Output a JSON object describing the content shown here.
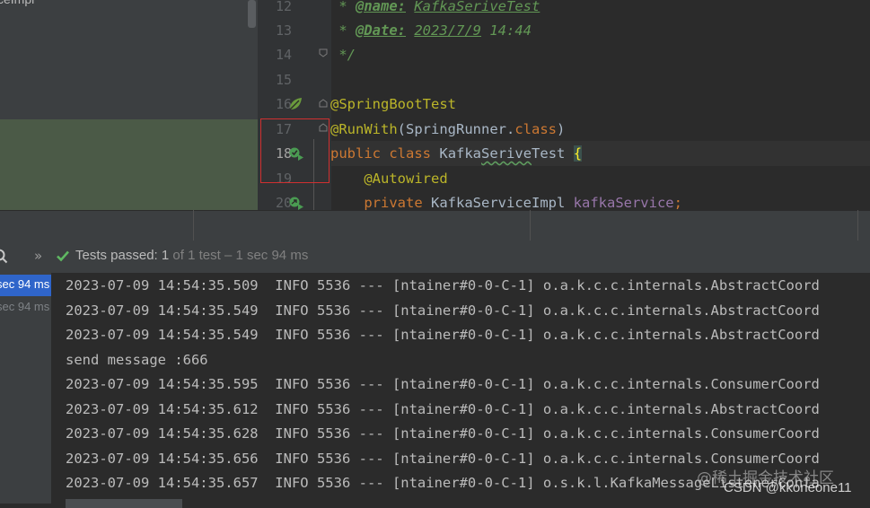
{
  "project_tree": {
    "item_label": "ceImpl"
  },
  "editor": {
    "line_numbers": [
      "12",
      "13",
      "14",
      "15",
      "16",
      "17",
      "18",
      "19",
      "20"
    ],
    "lines": {
      "l12": {
        "prefix": " * ",
        "tag": "@name:",
        "value": "KafkaSeriveTest"
      },
      "l13": {
        "prefix": " * ",
        "tag": "@Date:",
        "value": "2023/7/9",
        "rest": " 14:44"
      },
      "l14": {
        "text": " */"
      },
      "l16": {
        "annotation": "@SpringBootTest"
      },
      "l17": {
        "annotation": "@RunWith",
        "open": "(",
        "class_name": "SpringRunner",
        "dot": ".",
        "kw_class": "class",
        "close": ")"
      },
      "l18": {
        "kw_public": "public",
        "kw_class": "class",
        "name_pre": "Kafka",
        "name_squig": "Serive",
        "name_post": "Test",
        "brace": "{"
      },
      "l19": {
        "annotation": "@Autowired"
      },
      "l20": {
        "kw_private": "private",
        "type": "KafkaServiceImpl",
        "field": "kafkaService",
        "semi": ";"
      }
    }
  },
  "run_panel": {
    "status": {
      "label": "Tests passed:",
      "count": "1",
      "detail": "of 1 test – 1 sec 94 ms"
    },
    "results": [
      "sec 94 ms",
      "sec 94 ms"
    ],
    "console_lines": [
      "2023-07-09 14:54:35.509  INFO 5536 --- [ntainer#0-0-C-1] o.a.k.c.c.internals.AbstractCoord",
      "2023-07-09 14:54:35.549  INFO 5536 --- [ntainer#0-0-C-1] o.a.k.c.c.internals.AbstractCoord",
      "2023-07-09 14:54:35.549  INFO 5536 --- [ntainer#0-0-C-1] o.a.k.c.c.internals.AbstractCoord",
      "send message :666",
      "2023-07-09 14:54:35.595  INFO 5536 --- [ntainer#0-0-C-1] o.a.k.c.c.internals.ConsumerCoord",
      "2023-07-09 14:54:35.612  INFO 5536 --- [ntainer#0-0-C-1] o.a.k.c.c.internals.AbstractCoord",
      "2023-07-09 14:54:35.628  INFO 5536 --- [ntainer#0-0-C-1] o.a.k.c.c.internals.ConsumerCoord",
      "2023-07-09 14:54:35.656  INFO 5536 --- [ntainer#0-0-C-1] o.a.k.c.c.internals.ConsumerCoord",
      "2023-07-09 14:54:35.657  INFO 5536 --- [ntainer#0-0-C-1] o.s.k.l.KafkaMessageListenerConta"
    ]
  },
  "watermark": {
    "line1": "@稀土掘金技术社区",
    "line2": "CSDN @kkoneone11"
  }
}
